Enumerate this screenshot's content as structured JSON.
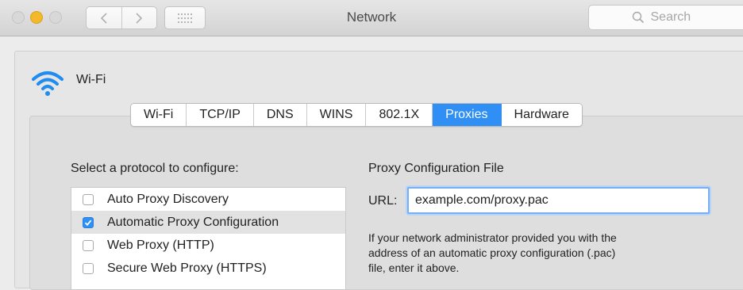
{
  "window": {
    "title": "Network",
    "search_placeholder": "Search"
  },
  "interface": {
    "name": "Wi-Fi"
  },
  "tabs": [
    {
      "label": "Wi-Fi",
      "active": false
    },
    {
      "label": "TCP/IP",
      "active": false
    },
    {
      "label": "DNS",
      "active": false
    },
    {
      "label": "WINS",
      "active": false
    },
    {
      "label": "802.1X",
      "active": false
    },
    {
      "label": "Proxies",
      "active": true
    },
    {
      "label": "Hardware",
      "active": false
    }
  ],
  "protocols": {
    "heading": "Select a protocol to configure:",
    "items": [
      {
        "label": "Auto Proxy Discovery",
        "checked": false
      },
      {
        "label": "Automatic Proxy Configuration",
        "checked": true
      },
      {
        "label": "Web Proxy (HTTP)",
        "checked": false
      },
      {
        "label": "Secure Web Proxy (HTTPS)",
        "checked": false
      }
    ]
  },
  "proxy_config": {
    "heading": "Proxy Configuration File",
    "url_label": "URL:",
    "url_value": "example.com/proxy.pac",
    "help_line1": "If your network administrator provided you with the",
    "help_line2": "address of an automatic proxy configuration (.pac)",
    "help_line3": "file, enter it above."
  },
  "colors": {
    "accent": "#2f8ff4",
    "minimize_light": "#f4b92b",
    "wifi_icon": "#1f8cf0"
  },
  "icons": {
    "back": "chevron-left-icon",
    "forward": "chevron-right-icon",
    "show_all": "grid-icon",
    "search": "search-icon",
    "wifi": "wifi-icon",
    "checkmark": "checkmark-icon"
  }
}
